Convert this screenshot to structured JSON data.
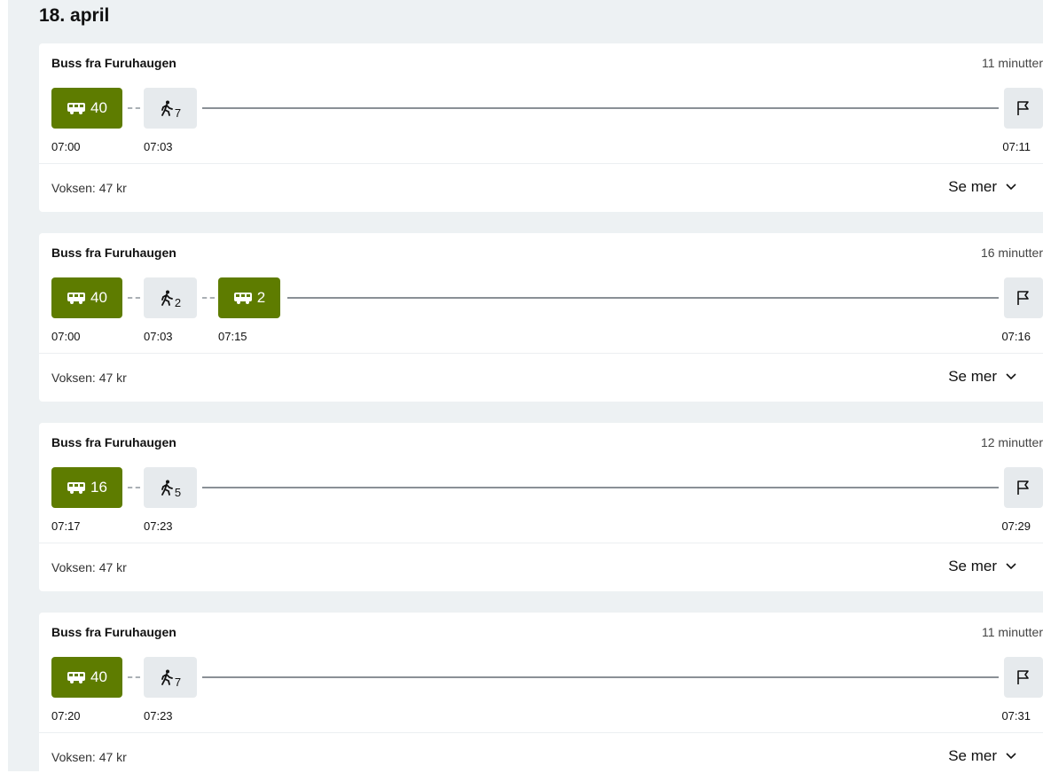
{
  "date_heading": "18. april",
  "trips": [
    {
      "title": "Buss fra Furuhaugen",
      "duration": "11 minutter",
      "legs": [
        {
          "type": "bus",
          "label": "40",
          "time": "07:00"
        },
        {
          "type": "walk",
          "label": "7",
          "time": "07:03"
        }
      ],
      "arrival_time": "07:11",
      "price": "Voksen: 47 kr",
      "more_label": "Se mer"
    },
    {
      "title": "Buss fra Furuhaugen",
      "duration": "16 minutter",
      "legs": [
        {
          "type": "bus",
          "label": "40",
          "time": "07:00"
        },
        {
          "type": "walk",
          "label": "2",
          "time": "07:03"
        },
        {
          "type": "bus",
          "label": "2",
          "time": "07:15"
        }
      ],
      "arrival_time": "07:16",
      "price": "Voksen: 47 kr",
      "more_label": "Se mer"
    },
    {
      "title": "Buss fra Furuhaugen",
      "duration": "12 minutter",
      "legs": [
        {
          "type": "bus",
          "label": "16",
          "time": "07:17"
        },
        {
          "type": "walk",
          "label": "5",
          "time": "07:23"
        }
      ],
      "arrival_time": "07:29",
      "price": "Voksen: 47 kr",
      "more_label": "Se mer"
    },
    {
      "title": "Buss fra Furuhaugen",
      "duration": "11 minutter",
      "legs": [
        {
          "type": "bus",
          "label": "40",
          "time": "07:20"
        },
        {
          "type": "walk",
          "label": "7",
          "time": "07:23"
        }
      ],
      "arrival_time": "07:31",
      "price": "Voksen: 47 kr",
      "more_label": "Se mer"
    }
  ],
  "icons": {
    "bus": "bus-icon",
    "walk": "walk-icon",
    "destination": "flag-icon",
    "expand": "chevron-down-icon"
  },
  "colors": {
    "bus_chip": "#5e7c00",
    "walk_chip": "#e6eaed",
    "background": "#edf1f3"
  }
}
